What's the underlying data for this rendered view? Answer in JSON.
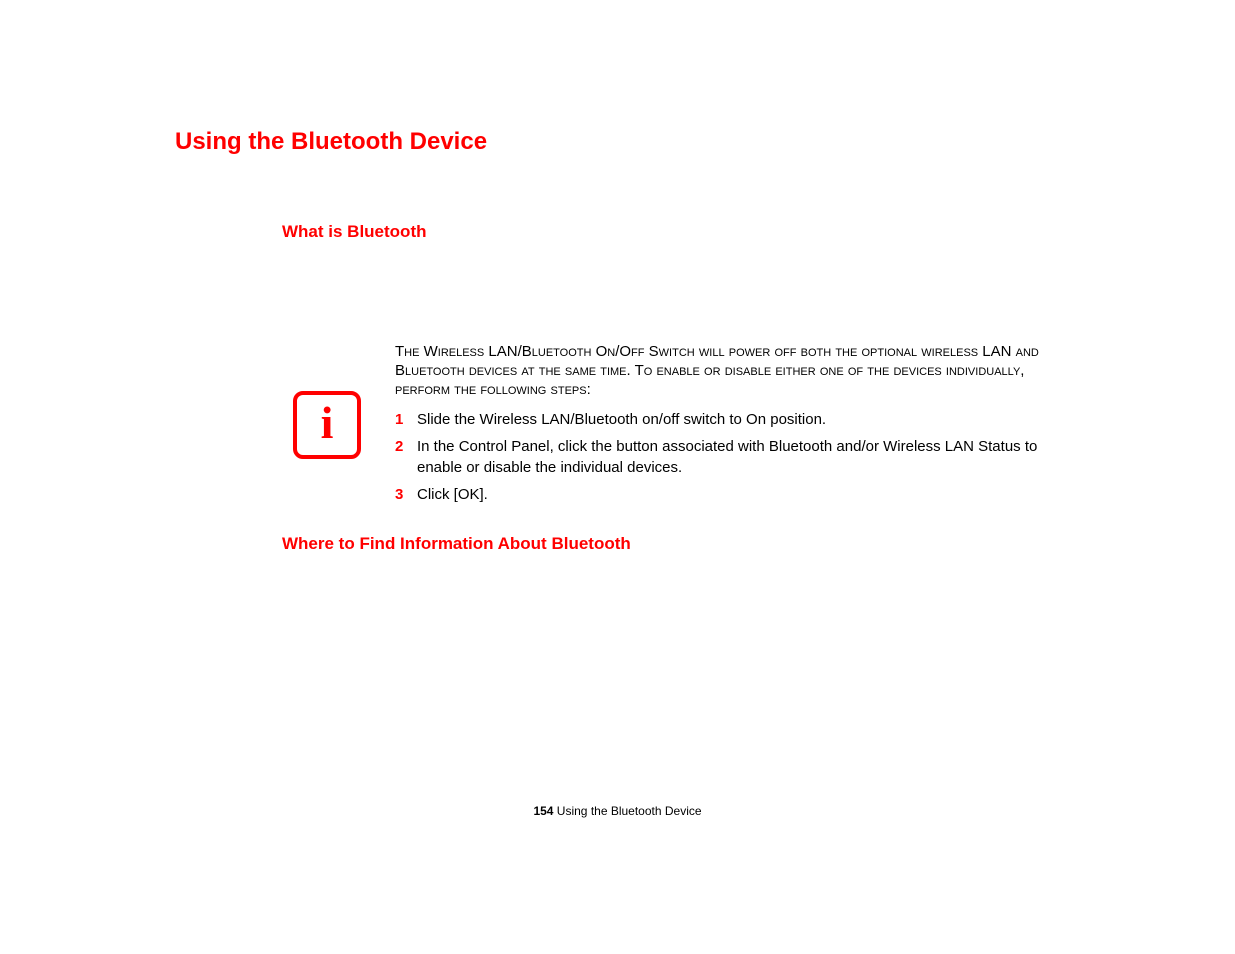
{
  "title": "Using the Bluetooth Device",
  "section1_heading": "What is Bluetooth",
  "info_intro": "The Wireless LAN/Bluetooth On/Off Switch will power off both the optional wireless LAN and Bluetooth devices at the same time. To enable or disable either one of the devices individually, perform the following steps:",
  "steps": [
    {
      "num": "1",
      "text": "Slide the Wireless LAN/Bluetooth on/off switch to On position."
    },
    {
      "num": "2",
      "text": "In the Control Panel, click the button associated with Bluetooth and/or Wireless LAN Status to enable or disable the individual devices."
    },
    {
      "num": "3",
      "text": "Click [OK]."
    }
  ],
  "section2_heading": "Where to Find Information About Bluetooth",
  "footer": {
    "page_num": "154",
    "page_label": " Using the Bluetooth Device"
  }
}
